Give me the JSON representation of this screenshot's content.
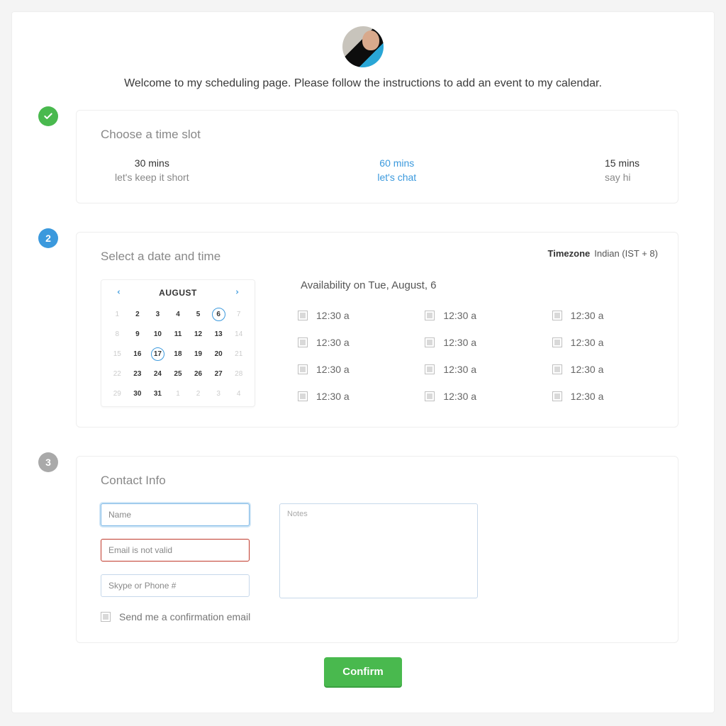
{
  "welcome": "Welcome to my scheduling page. Please follow the instructions to add an event to my calendar.",
  "step1": {
    "title": "Choose a time slot",
    "slots": [
      {
        "duration": "30 mins",
        "subtitle": "let's keep it short",
        "active": false
      },
      {
        "duration": "60 mins",
        "subtitle": "let's chat",
        "active": true
      },
      {
        "duration": "15 mins",
        "subtitle": "say hi",
        "active": false
      }
    ]
  },
  "step2": {
    "title": "Select a date and time",
    "timezone_label": "Timezone",
    "timezone_value": "Indian (IST + 8)",
    "month": "AUGUST",
    "availability_title": "Availability on Tue, August, 6",
    "calendar_rows": [
      [
        {
          "n": "1",
          "dim": true
        },
        {
          "n": "2"
        },
        {
          "n": "3"
        },
        {
          "n": "4"
        },
        {
          "n": "5"
        },
        {
          "n": "6",
          "sel": true
        },
        {
          "n": "7",
          "dim": true
        }
      ],
      [
        {
          "n": "8",
          "dim": true
        },
        {
          "n": "9"
        },
        {
          "n": "10"
        },
        {
          "n": "11"
        },
        {
          "n": "12"
        },
        {
          "n": "13"
        },
        {
          "n": "14",
          "dim": true
        }
      ],
      [
        {
          "n": "15",
          "dim": true
        },
        {
          "n": "16"
        },
        {
          "n": "17",
          "hl": true
        },
        {
          "n": "18"
        },
        {
          "n": "19"
        },
        {
          "n": "20"
        },
        {
          "n": "21",
          "dim": true
        }
      ],
      [
        {
          "n": "22",
          "dim": true
        },
        {
          "n": "23"
        },
        {
          "n": "24"
        },
        {
          "n": "25"
        },
        {
          "n": "26"
        },
        {
          "n": "27"
        },
        {
          "n": "28",
          "dim": true
        }
      ],
      [
        {
          "n": "29",
          "dim": true
        },
        {
          "n": "30"
        },
        {
          "n": "31"
        },
        {
          "n": "1",
          "dim": true
        },
        {
          "n": "2",
          "dim": true
        },
        {
          "n": "3",
          "dim": true
        },
        {
          "n": "4",
          "dim": true
        }
      ]
    ],
    "times": [
      "12:30 a",
      "12:30 a",
      "12:30 a",
      "12:30 a",
      "12:30 a",
      "12:30 a",
      "12:30 a",
      "12:30 a",
      "12:30 a",
      "12:30 a",
      "12:30 a",
      "12:30 a"
    ]
  },
  "step3": {
    "title": "Contact Info",
    "name_placeholder": "Name",
    "email_placeholder": "Email is not valid",
    "phone_placeholder": "Skype or Phone #",
    "notes_placeholder": "Notes",
    "confirm_checkbox": "Send me a confirmation email"
  },
  "confirm_button": "Confirm",
  "badges": {
    "step2": "2",
    "step3": "3"
  }
}
